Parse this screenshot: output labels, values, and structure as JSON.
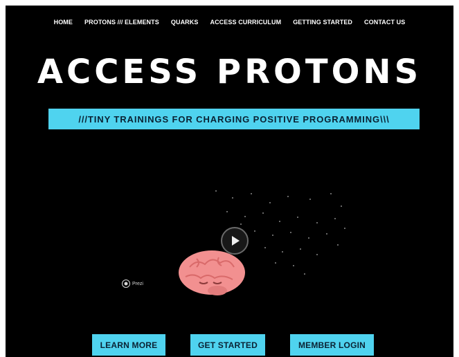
{
  "nav": {
    "items": [
      {
        "label": "HOME"
      },
      {
        "label": "PROTONS /// ELEMENTS"
      },
      {
        "label": "QUARKS"
      },
      {
        "label": "ACCESS CURRICULUM"
      },
      {
        "label": "GETTING STARTED"
      },
      {
        "label": "CONTACT US"
      }
    ]
  },
  "hero": {
    "title": "ACCESS PROTONS",
    "tagline": "///TINY TRAININGS FOR CHARGING POSITIVE PROGRAMMING\\\\\\"
  },
  "video": {
    "provider_label": "Prezi",
    "play_icon": "play-icon",
    "illustration": "brain-illustration"
  },
  "cta": {
    "learn_more": "LEARN MORE",
    "get_started": "GET STARTED",
    "member_login": "MEMBER LOGIN"
  },
  "colors": {
    "background": "#000000",
    "accent": "#4fd3ef",
    "text_light": "#ffffff",
    "brain": "#f08a8a"
  }
}
